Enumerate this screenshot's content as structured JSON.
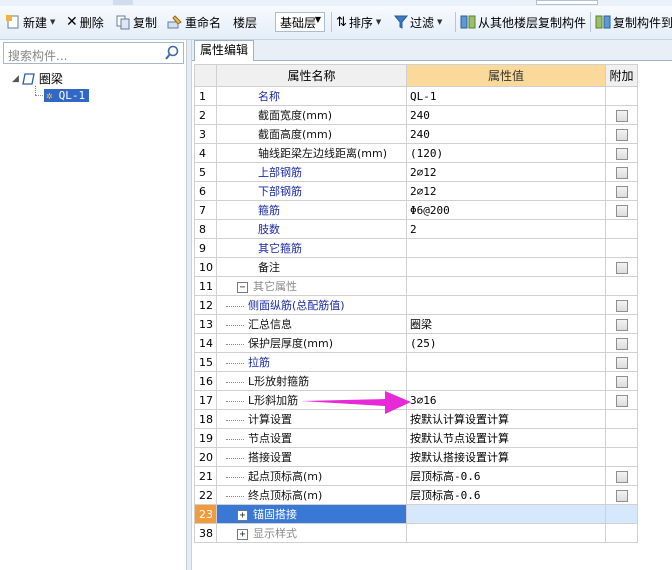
{
  "toolbar": {
    "new_label": "新建",
    "delete_label": "删除",
    "copy_label": "复制",
    "rename_label": "重命名",
    "floor_label": "楼层",
    "floor_value": "基础层",
    "sort_label": "排序",
    "filter_label": "过滤",
    "copy_from_other_label": "从其他楼层复制构件",
    "copy_to_label": "复制构件到"
  },
  "left_panel": {
    "search_placeholder": "搜索构件...",
    "tree": {
      "root_label": "圈梁",
      "child_label": "QL-1"
    }
  },
  "right_panel": {
    "tab_label": "属性编辑",
    "columns": {
      "name": "属性名称",
      "value": "属性值",
      "extra": "附加"
    },
    "rows": [
      {
        "num": "1",
        "name": "名称",
        "value": "QL-1",
        "style": "blue",
        "indent": false,
        "checkbox": false
      },
      {
        "num": "2",
        "name": "截面宽度(mm)",
        "value": "240",
        "style": "dark",
        "indent": false,
        "checkbox": true
      },
      {
        "num": "3",
        "name": "截面高度(mm)",
        "value": "240",
        "style": "dark",
        "indent": false,
        "checkbox": true
      },
      {
        "num": "4",
        "name": "轴线距梁左边线距离(mm)",
        "value": "(120)",
        "style": "dark",
        "indent": false,
        "checkbox": true
      },
      {
        "num": "5",
        "name": "上部钢筋",
        "value": "2⌀12",
        "style": "blue",
        "indent": false,
        "checkbox": true
      },
      {
        "num": "6",
        "name": "下部钢筋",
        "value": "2⌀12",
        "style": "blue",
        "indent": false,
        "checkbox": true
      },
      {
        "num": "7",
        "name": "箍筋",
        "value": "Φ6@200",
        "style": "blue",
        "indent": false,
        "checkbox": true
      },
      {
        "num": "8",
        "name": "肢数",
        "value": "2",
        "style": "blue",
        "indent": false,
        "checkbox": false
      },
      {
        "num": "9",
        "name": "其它箍筋",
        "value": "",
        "style": "blue",
        "indent": false,
        "checkbox": false
      },
      {
        "num": "10",
        "name": "备注",
        "value": "",
        "style": "dark",
        "indent": false,
        "checkbox": true
      },
      {
        "num": "11",
        "name": "其它属性",
        "value": "",
        "style": "gray",
        "indent": false,
        "checkbox": false,
        "expander": "−"
      },
      {
        "num": "12",
        "name": "侧面纵筋(总配筋值)",
        "value": "",
        "style": "blue",
        "indent": true,
        "checkbox": true
      },
      {
        "num": "13",
        "name": "汇总信息",
        "value": "圈梁",
        "style": "dark",
        "indent": true,
        "checkbox": true
      },
      {
        "num": "14",
        "name": "保护层厚度(mm)",
        "value": "(25)",
        "style": "dark",
        "indent": true,
        "checkbox": true
      },
      {
        "num": "15",
        "name": "拉筋",
        "value": "",
        "style": "blue",
        "indent": true,
        "checkbox": true
      },
      {
        "num": "16",
        "name": "L形放射箍筋",
        "value": "",
        "style": "dark",
        "indent": true,
        "checkbox": true
      },
      {
        "num": "17",
        "name": "L形斜加筋",
        "value": "3⌀16",
        "style": "dark",
        "indent": true,
        "checkbox": true
      },
      {
        "num": "18",
        "name": "计算设置",
        "value": "按默认计算设置计算",
        "style": "dark",
        "indent": true,
        "checkbox": false
      },
      {
        "num": "19",
        "name": "节点设置",
        "value": "按默认节点设置计算",
        "style": "dark",
        "indent": true,
        "checkbox": false
      },
      {
        "num": "20",
        "name": "搭接设置",
        "value": "按默认搭接设置计算",
        "style": "dark",
        "indent": true,
        "checkbox": false
      },
      {
        "num": "21",
        "name": "起点顶标高(m)",
        "value": "层顶标高-0.6",
        "style": "dark",
        "indent": true,
        "checkbox": true
      },
      {
        "num": "22",
        "name": "终点顶标高(m)",
        "value": "层顶标高-0.6",
        "style": "dark",
        "indent": true,
        "checkbox": true
      },
      {
        "num": "23",
        "name": "锚固搭接",
        "value": "",
        "style": "hl",
        "indent": false,
        "checkbox": false,
        "expander": "+"
      },
      {
        "num": "38",
        "name": "显示样式",
        "value": "",
        "style": "gray",
        "indent": false,
        "checkbox": false,
        "expander": "+"
      }
    ]
  },
  "colors": {
    "value_header": "#fbd99a",
    "highlight_row_num": "#f29b3a",
    "highlight_row_name": "#3a78d6",
    "arrow": "#e829d8",
    "blue_text": "#1a2aa8"
  }
}
